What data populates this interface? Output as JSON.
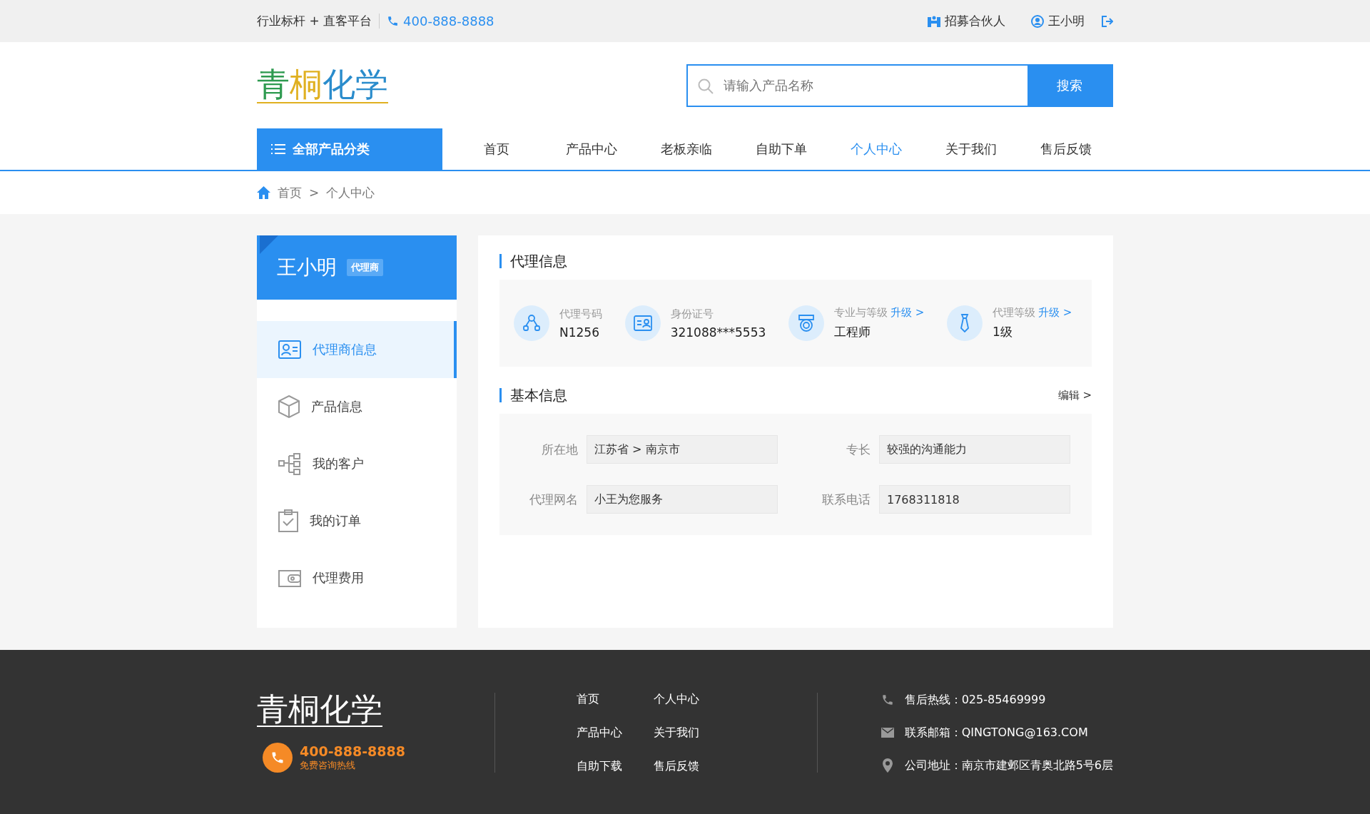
{
  "top_bar": {
    "slogan": "行业标杆 + 直客平台",
    "phone": "400-888-8888",
    "partner_link": "招募合伙人",
    "user_name": "王小明"
  },
  "logo": {
    "chars": [
      {
        "text": "青",
        "color": "#2e9a50"
      },
      {
        "text": "桐",
        "color": "#e0b020"
      },
      {
        "text": "化学",
        "color": "#2a8ccc"
      }
    ]
  },
  "search": {
    "placeholder": "请输入产品名称",
    "button": "搜索"
  },
  "nav": {
    "category_button": "全部产品分类",
    "items": [
      {
        "label": "首页",
        "selected": false
      },
      {
        "label": "产品中心",
        "selected": false
      },
      {
        "label": "老板亲临",
        "selected": false
      },
      {
        "label": "自助下单",
        "selected": false
      },
      {
        "label": "个人中心",
        "selected": true
      },
      {
        "label": "关于我们",
        "selected": false
      },
      {
        "label": "售后反馈",
        "selected": false
      }
    ]
  },
  "breadcrumb": [
    "首页",
    "个人中心"
  ],
  "breadcrumb_separator": ">",
  "sidebar": {
    "user_name": "王小明",
    "badge": "代理商",
    "items": [
      {
        "label": "代理商信息",
        "kind": "card",
        "selected": true
      },
      {
        "label": "产品信息",
        "kind": "box",
        "selected": false
      },
      {
        "label": "我的客户",
        "kind": "tree",
        "selected": false
      },
      {
        "label": "我的订单",
        "kind": "clipboard",
        "selected": false
      },
      {
        "label": "代理费用",
        "kind": "wallet",
        "selected": false
      }
    ]
  },
  "agent_info": {
    "title": "代理信息",
    "items": [
      {
        "kind": "network",
        "label": "代理号码",
        "value": "N1256"
      },
      {
        "kind": "idcard",
        "label": "身份证号",
        "value": "321088***5553"
      },
      {
        "kind": "medal",
        "label": "专业与等级",
        "link": "升级 >",
        "value": "工程师"
      },
      {
        "kind": "tie",
        "label": "代理等级",
        "link": "升级 >",
        "value": "1级"
      }
    ]
  },
  "basic_info": {
    "title": "基本信息",
    "edit_link": "编辑 >",
    "fields": [
      {
        "label": "所在地",
        "value": "江苏省 > 南京市"
      },
      {
        "label": "专长",
        "value": "较强的沟通能力"
      },
      {
        "label": "代理网名",
        "value": "小王为您服务"
      },
      {
        "label": "联系电话",
        "value": "1768311818"
      }
    ]
  },
  "footer": {
    "logo": "青桐化学",
    "hotline": "400-888-8888",
    "hotline_note": "免费咨询热线",
    "links": [
      "首页",
      "个人中心",
      "产品中心",
      "关于我们",
      "自助下载",
      "售后反馈"
    ],
    "contacts": [
      {
        "kind": "phone",
        "text": "售后热线：025-85469999"
      },
      {
        "kind": "mail",
        "text": "联系邮箱：QINGTONG@163.COM"
      },
      {
        "kind": "pin",
        "text": "公司地址：南京市建邺区青奥北路5号6层"
      }
    ]
  }
}
